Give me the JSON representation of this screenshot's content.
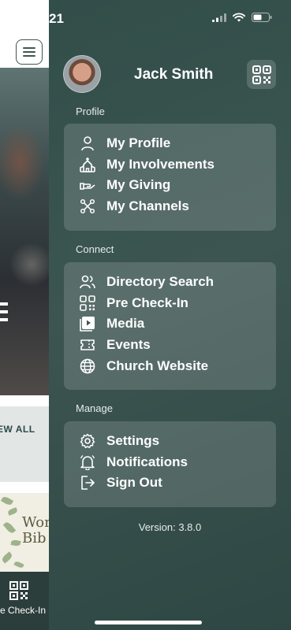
{
  "status_bar": {
    "time": "21"
  },
  "background_app": {
    "view_all": "EW ALL",
    "event_title_line1": "Wom",
    "event_title_line2": "Bib",
    "tab_label": "re Check-In"
  },
  "drawer": {
    "user_name": "Jack Smith",
    "sections": [
      {
        "title": "Profile",
        "items": [
          {
            "label": "My Profile",
            "icon": "person-icon"
          },
          {
            "label": "My Involvements",
            "icon": "church-icon"
          },
          {
            "label": "My Giving",
            "icon": "giving-hand-icon"
          },
          {
            "label": "My Channels",
            "icon": "channels-icon"
          }
        ]
      },
      {
        "title": "Connect",
        "items": [
          {
            "label": "Directory Search",
            "icon": "people-icon"
          },
          {
            "label": "Pre Check-In",
            "icon": "qr-code-icon"
          },
          {
            "label": "Media",
            "icon": "play-icon"
          },
          {
            "label": "Events",
            "icon": "ticket-icon"
          },
          {
            "label": "Church Website",
            "icon": "globe-icon"
          }
        ]
      },
      {
        "title": "Manage",
        "items": [
          {
            "label": "Settings",
            "icon": "gear-icon"
          },
          {
            "label": "Notifications",
            "icon": "bell-icon"
          },
          {
            "label": "Sign Out",
            "icon": "sign-out-icon"
          }
        ]
      }
    ],
    "version": "Version: 3.8.0"
  },
  "colors": {
    "drawer_bg": "#3c5551",
    "card_bg": "rgba(255,255,255,0.15)",
    "text": "#ffffff"
  }
}
